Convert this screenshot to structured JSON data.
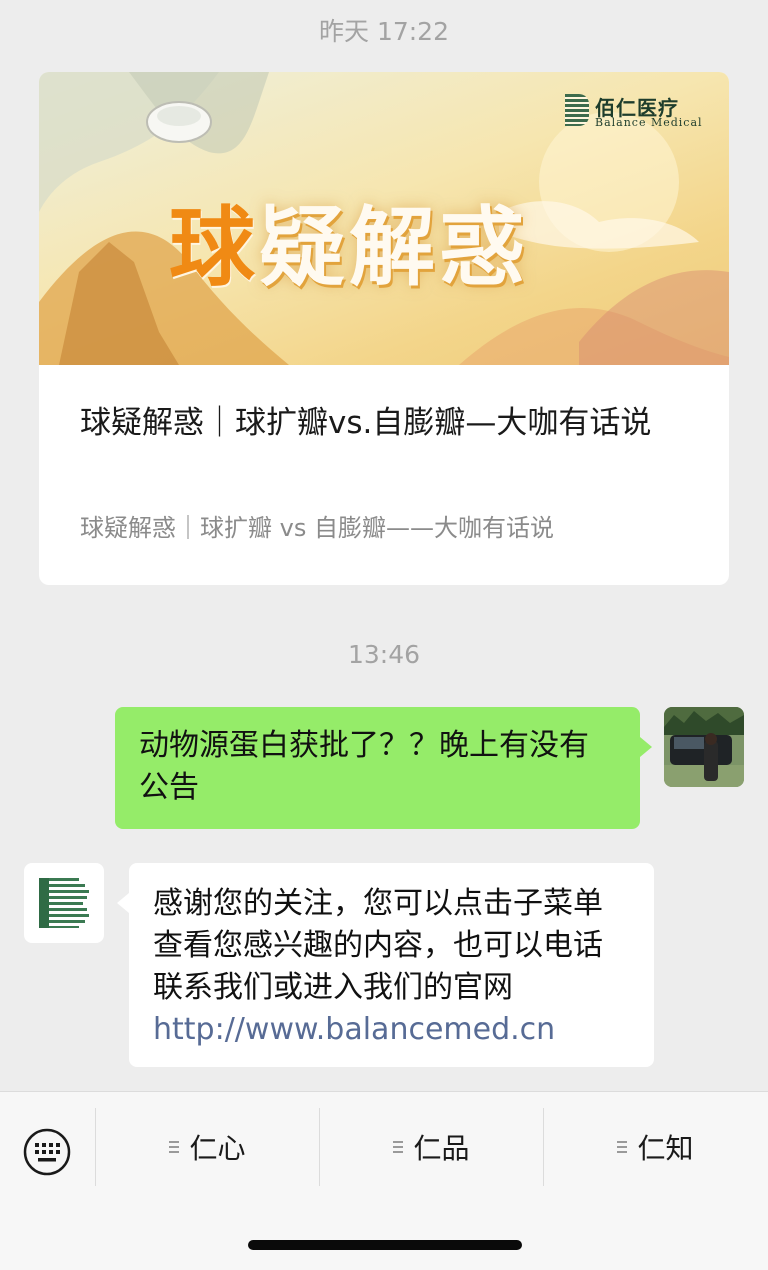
{
  "chat": {
    "timestamp_1": "昨天 17:22",
    "timestamp_2": "13:46",
    "article": {
      "cover_brand_cn": "佰仁医疗",
      "cover_brand_en": "Balance Medical",
      "cover_title_first": "球",
      "cover_title_rest": "疑解惑",
      "title": "球疑解惑｜球扩瓣vs.自膨瓣—大咖有话说",
      "description": "球疑解惑｜球扩瓣 vs 自膨瓣——大咖有话说"
    },
    "outgoing_message": "动物源蛋白获批了？？晚上有没有公告",
    "incoming_message": "感谢您的关注，您可以点击子菜单查看您感兴趣的内容，也可以电话联系我们或进入我们的官网",
    "incoming_link": "http://www.balancemed.cn"
  },
  "menu": {
    "keyboard_icon": "keyboard-icon",
    "items": [
      {
        "label": "仁心",
        "icon": "menu-lines-icon"
      },
      {
        "label": "仁品",
        "icon": "menu-lines-icon"
      },
      {
        "label": "仁知",
        "icon": "menu-lines-icon"
      }
    ]
  },
  "colors": {
    "background": "#ededed",
    "outgoing_bubble": "#95ec69",
    "incoming_bubble": "#ffffff",
    "link": "#576b95",
    "timestamp": "#a3a3a3"
  }
}
